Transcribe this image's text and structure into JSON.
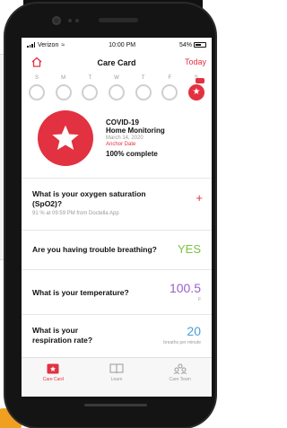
{
  "status_bar": {
    "carrier": "Verizon",
    "time": "10:00 PM",
    "battery": "54%"
  },
  "nav": {
    "title": "Care Card",
    "today_label": "Today"
  },
  "week": {
    "days": [
      "S",
      "M",
      "T",
      "W",
      "T",
      "F",
      "S"
    ]
  },
  "care_card": {
    "title_line1": "COVID-19",
    "title_line2": "Home Monitoring",
    "date": "March 14, 2020",
    "anchor": "Anchor Date",
    "progress": "100% complete"
  },
  "items": [
    {
      "question": "What is your oxygen saturation (SpO2)?",
      "detail": "91 % at 09:59 PM from Doctella App",
      "action": "+"
    },
    {
      "question": "Are you having trouble breathing?",
      "value": "YES"
    },
    {
      "question": "What is your temperature?",
      "value": "100.5",
      "unit": "F"
    },
    {
      "question": "What is your respiration rate?",
      "value": "20",
      "unit": "breaths per minute"
    }
  ],
  "tabs": [
    {
      "label": "Care Card",
      "icon": "care-card-icon",
      "active": true
    },
    {
      "label": "Learn",
      "icon": "book-icon",
      "active": false
    },
    {
      "label": "Care Team",
      "icon": "team-icon",
      "active": false
    }
  ],
  "colors": {
    "accent_red": "#e23140",
    "yes_green": "#7cc242",
    "temp_purple": "#9c5fc9",
    "resp_blue": "#4a9fd8"
  }
}
